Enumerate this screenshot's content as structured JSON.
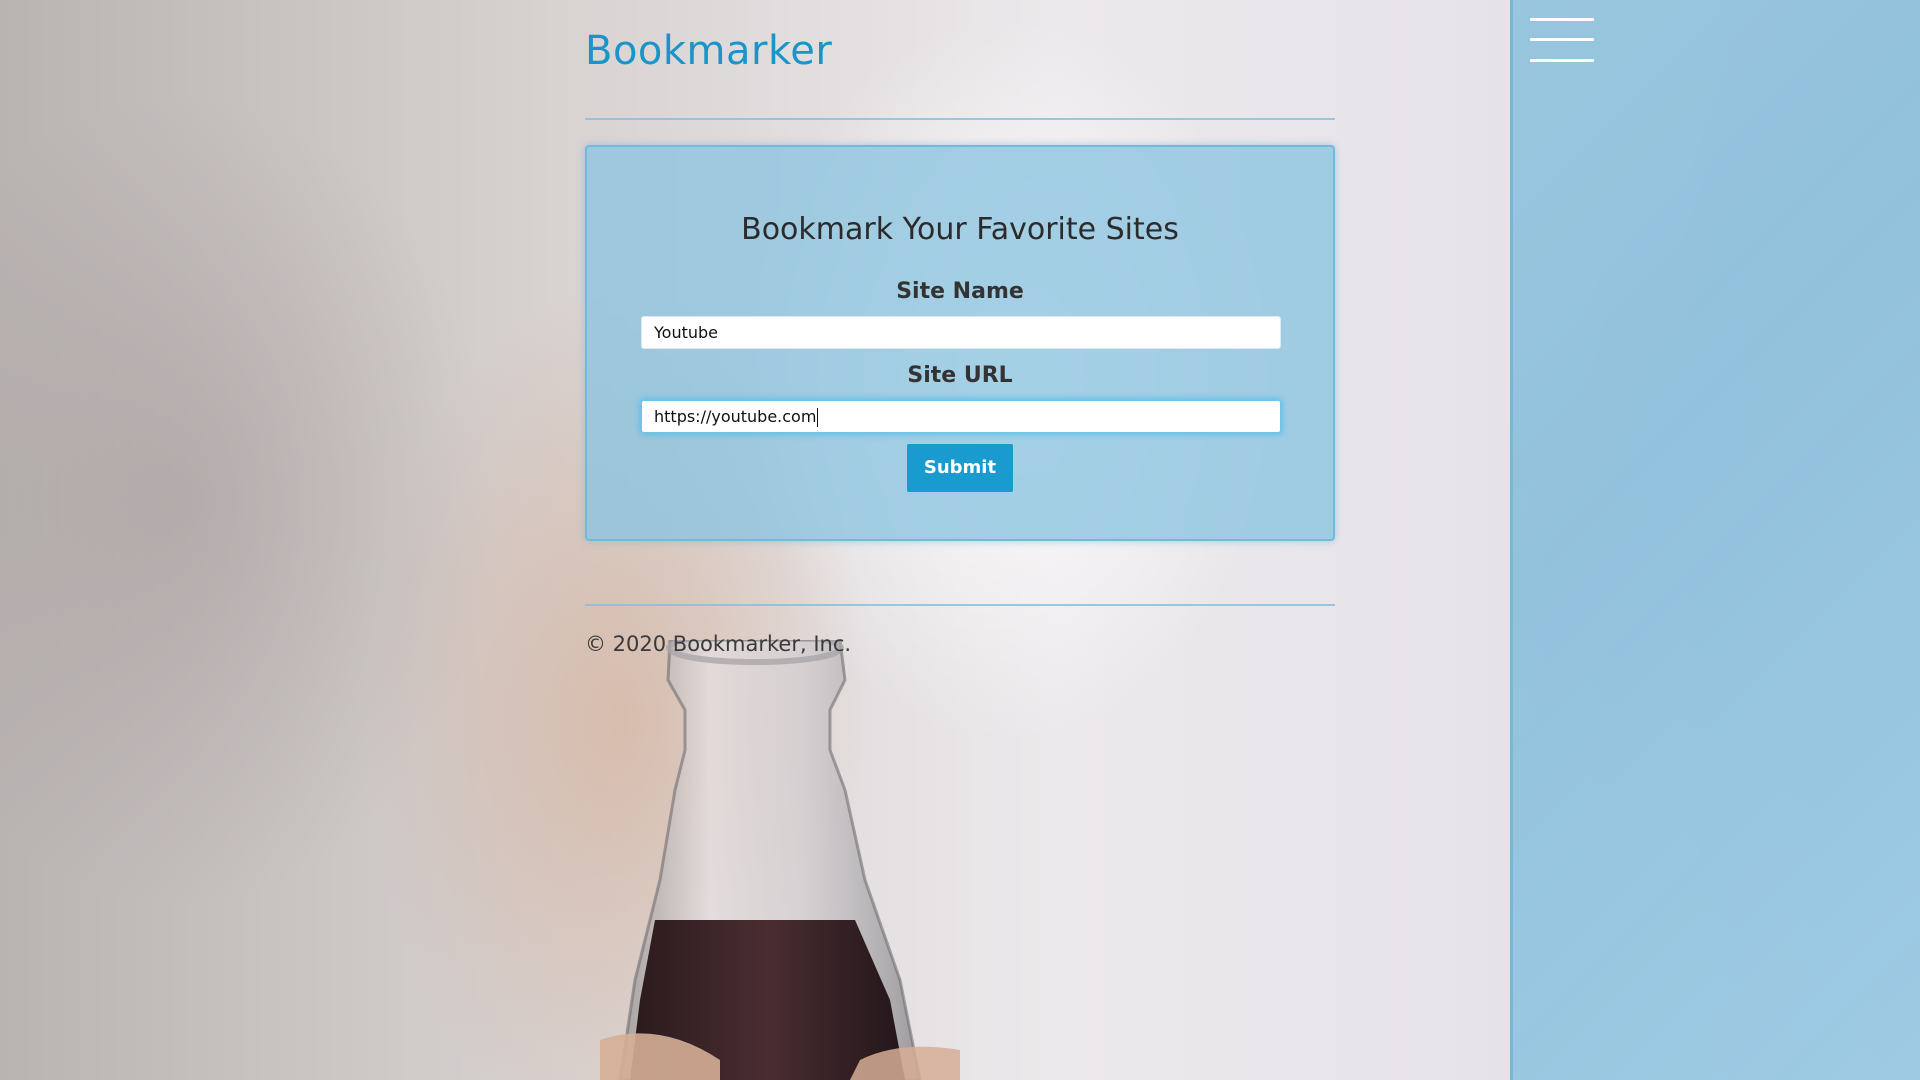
{
  "header": {
    "title": "Bookmarker"
  },
  "form": {
    "heading": "Bookmark Your Favorite Sites",
    "site_name_label": "Site Name",
    "site_name_value": "Youtube",
    "site_url_label": "Site URL",
    "site_url_value": "https://youtube.com",
    "submit_label": "Submit"
  },
  "footer": {
    "text": "© 2020 Bookmarker, Inc."
  },
  "sidebar": {
    "menu_icon": "hamburger-menu-icon"
  },
  "colors": {
    "accent": "#1a9bd0",
    "title": "#1a95c9",
    "card": "#8cc4e0",
    "sidebar": "#96c4de"
  }
}
